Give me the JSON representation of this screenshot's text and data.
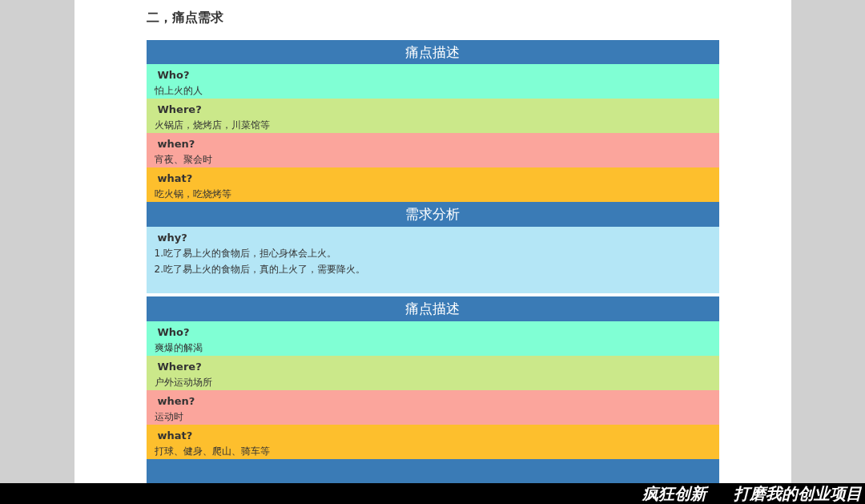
{
  "heading": "二，痛点需求",
  "sections": [
    {
      "kind": "description",
      "header": "痛点描述",
      "rows": [
        {
          "label": "Who?",
          "text": "怕上火的人",
          "color": "#80ffd4"
        },
        {
          "label": "Where?",
          "text": "火锅店，烧烤店，川菜馆等",
          "color": "#cbe88a"
        },
        {
          "label": "when?",
          "text": "宵夜、聚会时",
          "color": "#fba59c"
        },
        {
          "label": "what?",
          "text": "吃火锅，吃烧烤等",
          "color": "#fdbf2d"
        }
      ]
    },
    {
      "kind": "analysis",
      "header": "需求分析",
      "label": "why?",
      "lines": [
        "1.吃了易上火的食物后，担心身体会上火。",
        "2.吃了易上火的食物后，真的上火了，需要降火。"
      ]
    },
    {
      "kind": "description",
      "header": "痛点描述",
      "rows": [
        {
          "label": "Who?",
          "text": "爽爆的解渴",
          "color": "#80ffd4"
        },
        {
          "label": "Where?",
          "text": "户外运动场所",
          "color": "#cbe88a"
        },
        {
          "label": "when?",
          "text": "运动时",
          "color": "#fba59c"
        },
        {
          "label": "what?",
          "text": "打球、健身、爬山、骑车等",
          "color": "#fdbf2d"
        }
      ]
    },
    {
      "kind": "analysis"
    }
  ],
  "banner": {
    "left": "疯狂创新",
    "right": "打磨我的创业项目"
  }
}
